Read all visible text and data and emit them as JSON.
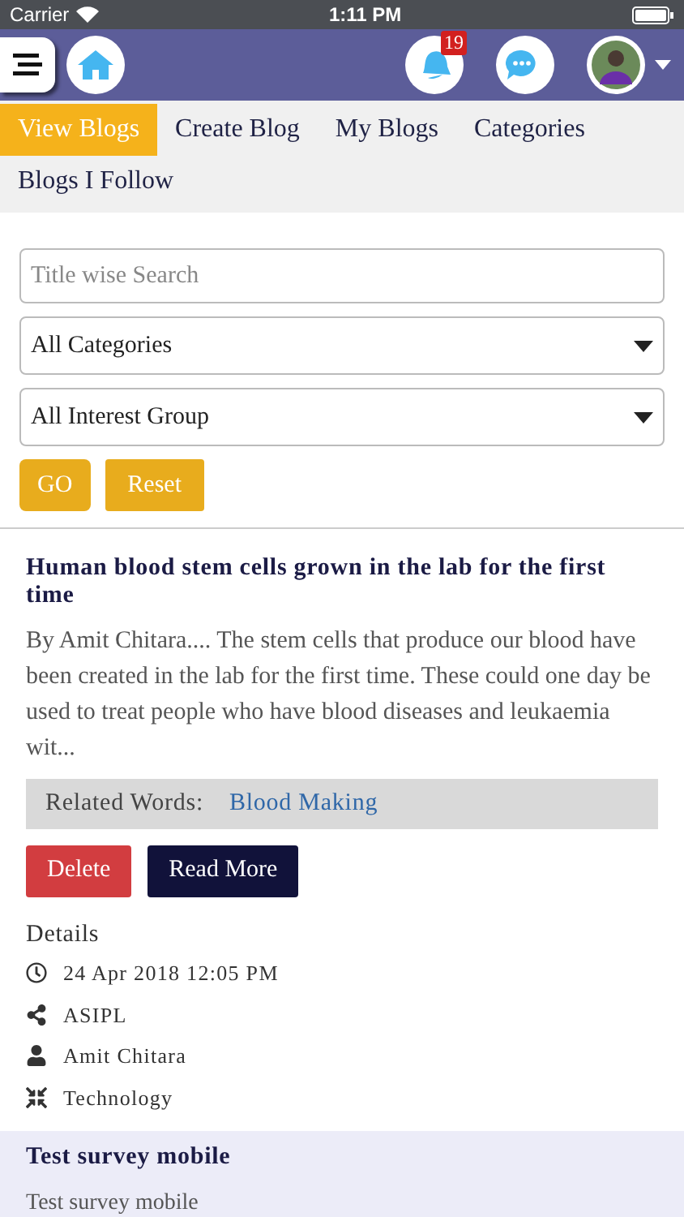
{
  "status_bar": {
    "carrier": "Carrier",
    "time": "1:11 PM"
  },
  "header": {
    "notification_count": "19"
  },
  "tabs": [
    {
      "label": "View Blogs",
      "selected": true
    },
    {
      "label": "Create Blog",
      "selected": false
    },
    {
      "label": "My Blogs",
      "selected": false
    },
    {
      "label": "Categories",
      "selected": false
    },
    {
      "label": "Blogs I Follow",
      "selected": false
    }
  ],
  "filters": {
    "search": {
      "placeholder": "Title wise Search"
    },
    "category": "All Categories",
    "interest_group": "All Interest Group",
    "buttons": [
      "GO",
      "Reset"
    ]
  },
  "posts": [
    {
      "title": "Human blood stem cells grown in the lab for the first time",
      "excerpt": "By Amit Chitara.... The stem cells that produce our blood have been created in the lab for the first time. These could one day be used to treat people who have blood diseases and leukaemia wit...",
      "related_label": "Related Words:",
      "related_word": "Blood Making",
      "buttons": [
        "Delete",
        "Read More"
      ],
      "details_heading": "Details",
      "details": [
        {
          "kind": "date",
          "text": "24 Apr 2018 12:05 PM"
        },
        {
          "kind": "group",
          "text": "ASIPL"
        },
        {
          "kind": "author",
          "text": "Amit Chitara"
        },
        {
          "kind": "category",
          "text": "Technology"
        }
      ]
    },
    {
      "title": "Test survey mobile",
      "excerpt": "Test survey mobile"
    }
  ]
}
